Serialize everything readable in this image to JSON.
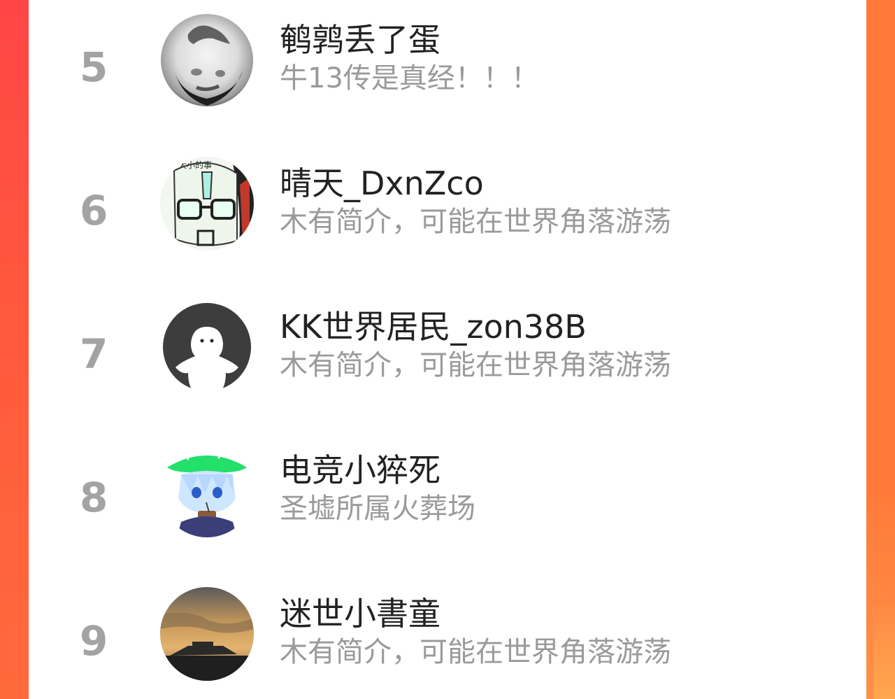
{
  "ranking": {
    "entries": [
      {
        "rank": "5",
        "username": "鹌鹑丢了蛋",
        "bio": "牛13传是真经！！！",
        "avatar_icon": "grainy-sphere-face-avatar-icon"
      },
      {
        "rank": "6",
        "username": "晴天_DxnZco",
        "bio": "木有简介，可能在世界角落游荡",
        "avatar_icon": "ultraman-sketch-avatar-icon"
      },
      {
        "rank": "7",
        "username": "KK世界居民_zon38B",
        "bio": "木有简介，可能在世界角落游荡",
        "avatar_icon": "default-ghost-avatar-icon"
      },
      {
        "rank": "8",
        "username": "电竞小猝死",
        "bio": "圣墟所属火葬场",
        "avatar_icon": "anime-boy-green-hat-avatar-icon"
      },
      {
        "rank": "9",
        "username": "迷世小書童",
        "bio": "木有简介，可能在世界角落游荡",
        "avatar_icon": "sunset-landscape-avatar-icon"
      }
    ]
  },
  "colors": {
    "frame_left": "#ff4646",
    "frame_right": "#ff7a3a",
    "card_background": "#ffffff",
    "rank_number": "#a3a3a3",
    "username": "#222222",
    "bio": "#9a9a9a"
  }
}
